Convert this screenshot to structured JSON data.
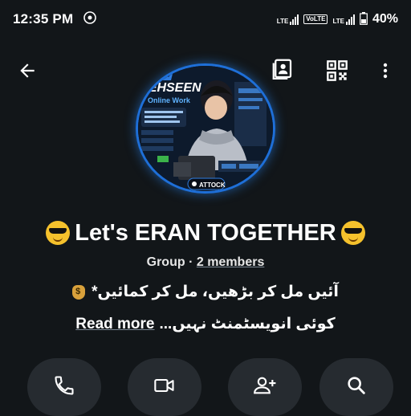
{
  "status_bar": {
    "time": "12:35 PM",
    "lte1": "LTE",
    "volte": "VoLTE",
    "lte2": "LTE",
    "battery": "40%"
  },
  "avatar_text": {
    "brand": "TEHSEEN",
    "tagline": "Online Work",
    "place": "ATTOCK"
  },
  "group": {
    "name": "Let's ERAN TOGETHER",
    "type": "Group",
    "separator": "·",
    "members": "2 members",
    "desc_line1": "آئیں مل کر بڑھیں، مل کر کمائیں*",
    "desc_line2": "کوئی انویسٹمنٹ نہیں...",
    "read_more": "Read more"
  },
  "icons": {
    "back": "arrow-left-icon",
    "contact": "contact-card-icon",
    "qr": "qr-code-icon",
    "more": "more-vert-icon",
    "call": "phone-icon",
    "video": "video-icon",
    "add_member": "person-add-icon",
    "search": "search-icon"
  },
  "colors": {
    "background": "#121619",
    "button_bg": "#262b30",
    "avatar_ring": "#1e6fd8"
  }
}
